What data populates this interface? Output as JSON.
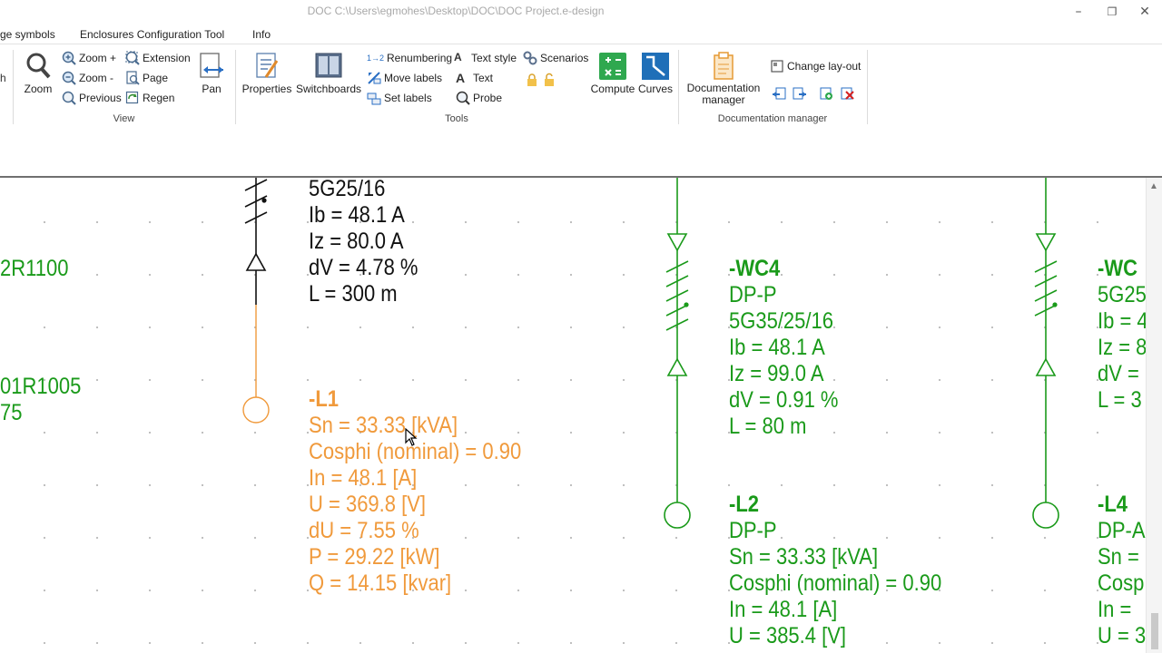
{
  "window": {
    "title": "DOC C:\\Users\\egmohes\\Desktop\\DOC\\DOC Project.e-design",
    "minimize": "–",
    "restore": "❐",
    "close": "✕"
  },
  "tabs": [
    {
      "label": "ge symbols"
    },
    {
      "label": "Enclosures Configuration Tool"
    },
    {
      "label": "Info"
    }
  ],
  "ribbon": {
    "view": {
      "label": "View",
      "zoom": "Zoom",
      "zoom_in": "Zoom +",
      "zoom_out": "Zoom -",
      "previous": "Previous",
      "extension": "Extension",
      "page": "Page",
      "regen": "Regen",
      "pan": "Pan"
    },
    "tools": {
      "label": "Tools",
      "properties": "Properties",
      "switchboards": "Switchboards",
      "renumbering": "Renumbering",
      "renumbering_prefix": "1→2",
      "move_labels": "Move labels",
      "set_labels": "Set labels",
      "text_style": "Text style",
      "text": "Text",
      "scenarios": "Scenarios",
      "probe": "Probe",
      "compute": "Compute",
      "curves": "Curves"
    },
    "documentation": {
      "label": "Documentation manager",
      "manager_line1": "Documentation",
      "manager_line2": "manager",
      "change_layout": "Change lay-out"
    }
  },
  "canvas": {
    "left_labels": {
      "l1": "2R1100",
      "l2": "01R1005",
      "l3": "75"
    },
    "cable1": [
      "5G25/16",
      "Ib = 48.1 A",
      "Iz = 80.0 A",
      "dV = 4.78 %",
      "L = 300 m"
    ],
    "load1": {
      "name": "-L1",
      "lines": [
        "Sn = 33.33 [kVA]",
        "Cosphi (nominal) = 0.90",
        "In = 48.1 [A]",
        "U = 369.8 [V]",
        "dU = 7.55 %",
        "P = 29.22 [kW]",
        "Q = 14.15 [kvar]"
      ]
    },
    "cable4": {
      "name": "-WC4",
      "lines": [
        "DP-P",
        "5G35/25/16",
        "Ib = 48.1 A",
        "Iz = 99.0 A",
        "dV = 0.91 %",
        "L = 80 m"
      ]
    },
    "load2": {
      "name": "-L2",
      "lines": [
        "DP-P",
        "Sn = 33.33 [kVA]",
        "Cosphi (nominal) = 0.90",
        "In = 48.1 [A]",
        "U = 385.4 [V]"
      ]
    },
    "cable5": {
      "name": "-WC",
      "lines": [
        "5G25",
        "Ib = 4",
        "Iz = 8",
        "dV =",
        "L = 3"
      ]
    },
    "load4": {
      "name": "-L4",
      "lines": [
        "DP-A",
        "Sn =",
        "Cosp",
        "In =",
        "U = 3"
      ]
    },
    "colors": {
      "black": "#111111",
      "green": "#1a9a1a",
      "orange": "#f09a3c"
    }
  }
}
